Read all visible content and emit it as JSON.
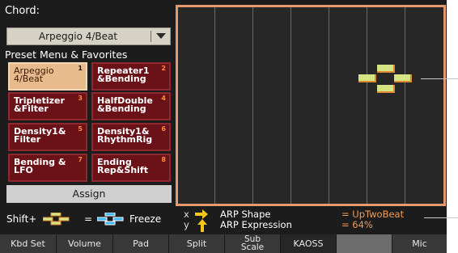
{
  "chord_label": "Chord:",
  "dropdown_value": "Arpeggio 4/Beat",
  "preset_title": "Preset Menu & Favorites",
  "presets": [
    {
      "label": "Arpeggio\n4/Beat",
      "num": "1",
      "selected": true
    },
    {
      "label": "Repeater1\n&Bending",
      "num": "2"
    },
    {
      "label": "Tripletizer\n&Filter",
      "num": "3"
    },
    {
      "label": "HalfDouble\n&Bending",
      "num": "4"
    },
    {
      "label": "Density1&\nFilter",
      "num": "5"
    },
    {
      "label": "Density1&\nRhythmRig",
      "num": "6"
    },
    {
      "label": "Bending &\nLFO",
      "num": "7"
    },
    {
      "label": "Ending\nRep&Shift",
      "num": "8"
    }
  ],
  "assign_label": "Assign",
  "shift_prefix": "Shift+",
  "equals": "=",
  "freeze_label": "Freeze",
  "x_axis": {
    "letter": "x",
    "name": "ARP Shape",
    "value": "= UpTwoBeat"
  },
  "y_axis": {
    "letter": "y",
    "name": "ARP Expression",
    "value": "= 64%"
  },
  "tabs": [
    "Kbd Set",
    "Volume",
    "Pad",
    "Split",
    "Sub\nScale",
    "KAOSS",
    "",
    "Mic"
  ],
  "colors": {
    "accent": "#e39a6c",
    "preset_bg": "#6b1219",
    "preset_selected": "#e8bb8d",
    "value_text": "#f19b55"
  }
}
